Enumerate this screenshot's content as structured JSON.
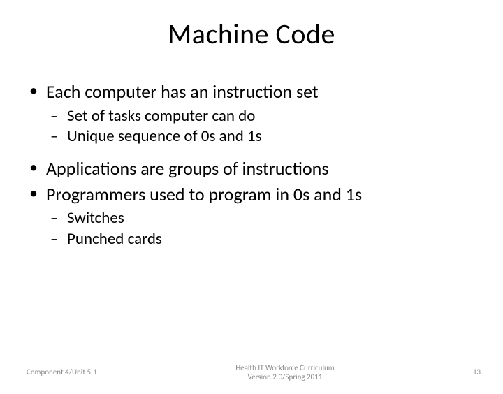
{
  "title": "Machine Code",
  "bullets": {
    "b1": "Each computer has an instruction set",
    "b1a": "Set of tasks computer can do",
    "b1b": "Unique sequence of 0s and 1s",
    "b2": "Applications are groups of instructions",
    "b3": "Programmers used to program in 0s and 1s",
    "b3a": "Switches",
    "b3b": "Punched cards"
  },
  "footer": {
    "left": "Component 4/Unit 5-1",
    "center_line1": "Health IT Workforce Curriculum",
    "center_line2": "Version 2.0/Spring 2011",
    "page": "13"
  }
}
